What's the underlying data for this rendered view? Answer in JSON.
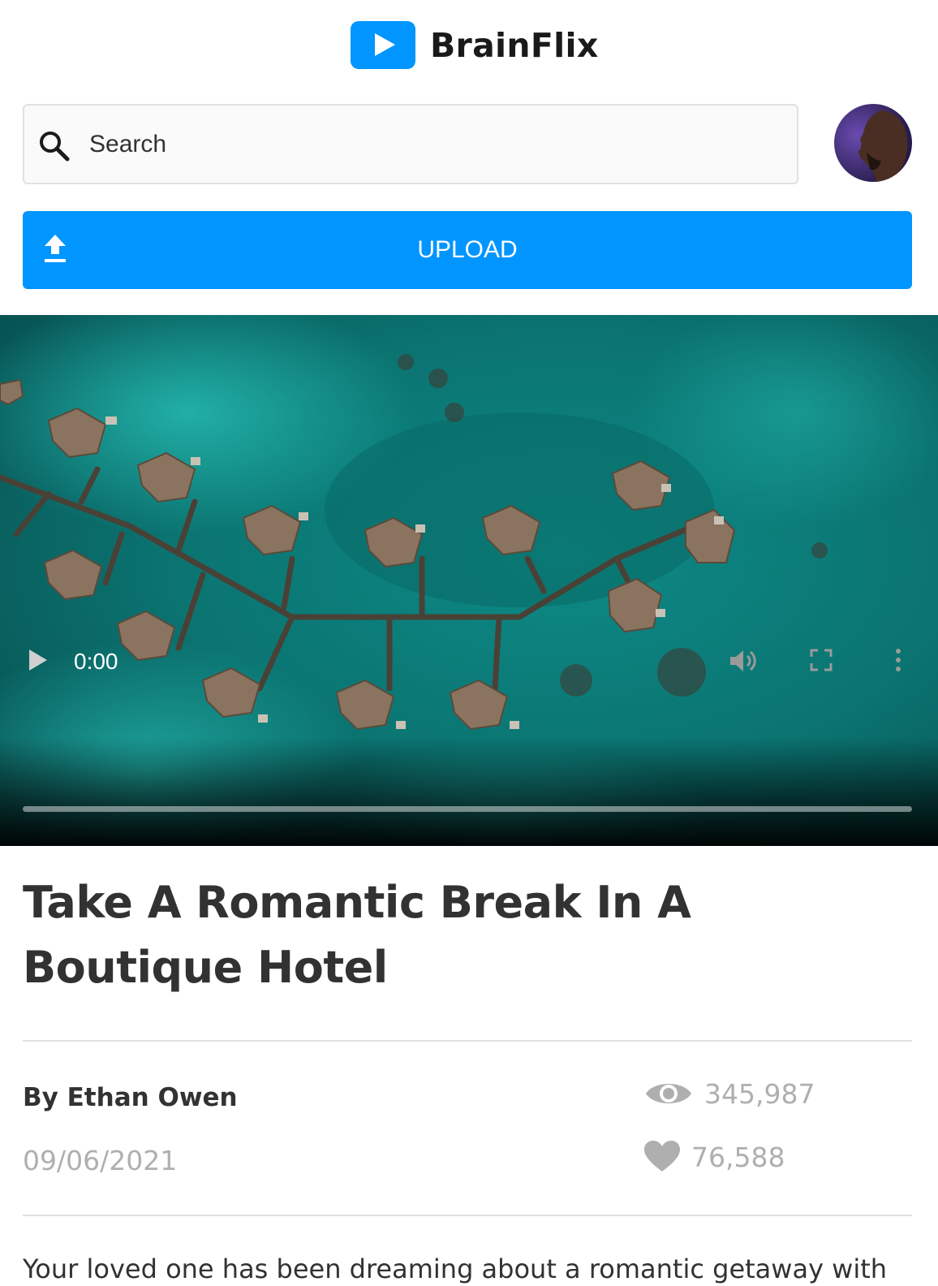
{
  "header": {
    "brand": "BrainFlix",
    "search_placeholder": "Search",
    "upload_label": "UPLOAD"
  },
  "video": {
    "time": "0:00",
    "progress": 0
  },
  "details": {
    "title": "Take A Romantic Break In A Boutique Hotel",
    "author": "By Ethan Owen",
    "date": "09/06/2021",
    "views": "345,987",
    "likes": "76,588",
    "description": "Your loved one has been dreaming about a romantic getaway with"
  },
  "colors": {
    "accent": "#0095FF",
    "text": "#323232",
    "muted": "#AFAFAF",
    "divider": "#E1E1E1"
  },
  "icons": [
    "play-logo-icon",
    "search-icon",
    "upload-icon",
    "play-icon",
    "volume-icon",
    "fullscreen-icon",
    "more-options-icon",
    "eye-icon",
    "heart-icon"
  ]
}
